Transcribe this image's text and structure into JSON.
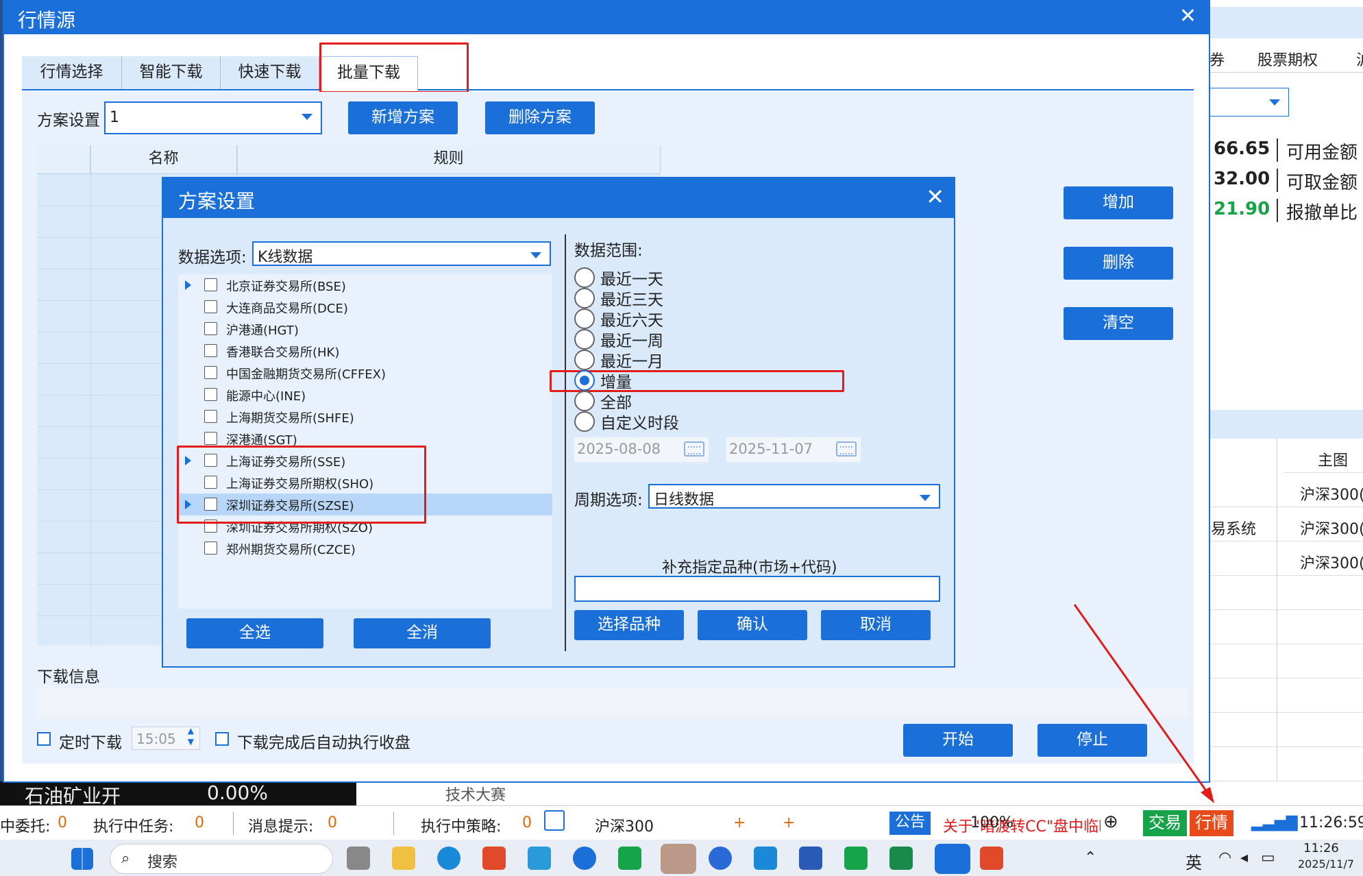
{
  "main_window": {
    "title": "行情源",
    "close": "✕",
    "tabs": [
      "行情选择",
      "智能下载",
      "快速下载",
      "批量下载"
    ],
    "scheme_label": "方案设置",
    "scheme_value": "1",
    "add_scheme": "新增方案",
    "delete_scheme": "删除方案",
    "table_headers": [
      "名称",
      "规则"
    ],
    "side_buttons": [
      "增加",
      "删除",
      "清空"
    ],
    "download_info_label": "下载信息",
    "timed_download_label": "定时下载",
    "timed_download_value": "15:05",
    "auto_close_label": "下载完成后自动执行收盘",
    "start": "开始",
    "stop": "停止"
  },
  "dialog": {
    "title": "方案设置",
    "close": "✕",
    "data_option_label": "数据选项:",
    "data_option_value": "K线数据",
    "markets": [
      {
        "name": "北京证券交易所(BSE)",
        "expand": true
      },
      {
        "name": "大连商品交易所(DCE)",
        "expand": false
      },
      {
        "name": "沪港通(HGT)",
        "expand": false
      },
      {
        "name": "香港联合交易所(HK)",
        "expand": false
      },
      {
        "name": "中国金融期货交易所(CFFEX)",
        "expand": false
      },
      {
        "name": "能源中心(INE)",
        "expand": false
      },
      {
        "name": "上海期货交易所(SHFE)",
        "expand": false
      },
      {
        "name": "深港通(SGT)",
        "expand": false
      },
      {
        "name": "上海证券交易所(SSE)",
        "expand": true
      },
      {
        "name": "上海证券交易所期权(SHO)",
        "expand": false
      },
      {
        "name": "深圳证券交易所(SZSE)",
        "expand": true
      },
      {
        "name": "深圳证券交易所期权(SZO)",
        "expand": false
      },
      {
        "name": "郑州期货交易所(CZCE)",
        "expand": false
      }
    ],
    "select_all": "全选",
    "deselect_all": "全消",
    "range_label": "数据范围:",
    "range_options": [
      "最近一天",
      "最近三天",
      "最近六天",
      "最近一周",
      "最近一月",
      "增量",
      "全部",
      "自定义时段"
    ],
    "range_selected_index": 5,
    "date_from": "2025-08-08",
    "date_to": "2025-11-07",
    "period_label": "周期选项:",
    "period_value": "日线数据",
    "supplement_label": "补充指定品种(市场+代码)",
    "supplement_value": "",
    "choose_symbol": "选择品种",
    "confirm": "确认",
    "cancel": "取消"
  },
  "background": {
    "tabs": [
      "券",
      "股票期权",
      "沪"
    ],
    "account": [
      {
        "value": "66.65",
        "label": "可用金额",
        "color": "#111111"
      },
      {
        "value": "32.00",
        "label": "可取金额",
        "color": "#111111"
      },
      {
        "value": "21.90",
        "label": "报撤单比",
        "color": "#17a34a"
      }
    ],
    "table_header": "主图",
    "rows": [
      {
        "left": "",
        "right": "沪深300("
      },
      {
        "left": "易系统",
        "right": "沪深300("
      },
      {
        "left": "",
        "right": "沪深300("
      }
    ],
    "ticker_left": "石油矿业开",
    "ticker_pct": "0.00%",
    "strip_text": "技术大赛"
  },
  "statusbar": {
    "pending_label": "中委托:",
    "pending_value": "0",
    "tasks_label": "执行中任务:",
    "tasks_value": "0",
    "msg_label": "消息提示:",
    "msg_value": "0",
    "strategy_label": "执行中策略:",
    "strategy_value": "0",
    "index_name": "沪深300",
    "plus1": "+",
    "plus2": "+",
    "announce": "公告",
    "news": "关于\"暗渡转CC\"盘中临时",
    "zoom": "100%",
    "trade": "交易",
    "quote": "行情",
    "time": "11:26:59"
  },
  "taskbar": {
    "search_placeholder": "搜索",
    "ime": "英",
    "clock_time": "11:26",
    "clock_date": "2025/11/7"
  },
  "colors": {
    "accent": "#1a6fd8",
    "highlight": "#e31b1b",
    "panel": "#dbeafb"
  }
}
